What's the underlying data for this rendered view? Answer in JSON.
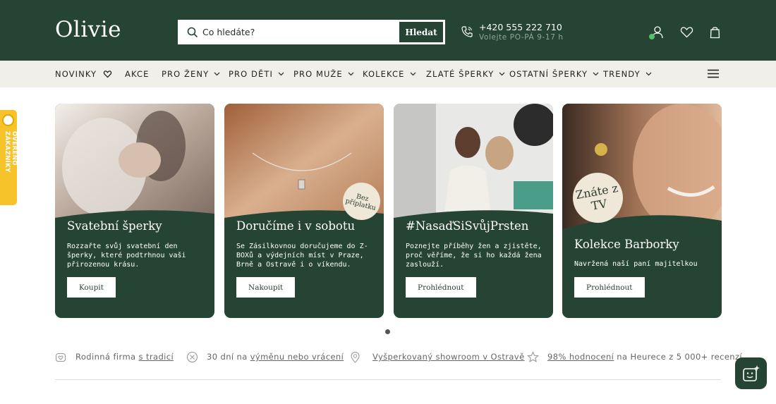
{
  "brand": {
    "logo_text": "Olivie",
    "primary_color": "#254433",
    "accent_color": "#f1efea"
  },
  "header": {
    "search_placeholder": "Co hledáte?",
    "search_button": "Hledat",
    "phone": "+420 555 222 710",
    "hours": "Volejte PO-PÁ 9-17 h",
    "icons": [
      "search-icon",
      "phone-icon",
      "user-icon",
      "heart-icon",
      "bag-icon"
    ]
  },
  "nav": {
    "items": [
      {
        "label": "NOVINKY",
        "icon": "heart-icon"
      },
      {
        "label": "AKCE"
      },
      {
        "label": "PRO ŽENY",
        "dropdown": true
      },
      {
        "label": "PRO DĚTI",
        "dropdown": true
      },
      {
        "label": "PRO MUŽE",
        "dropdown": true
      },
      {
        "label": "KOLEKCE",
        "dropdown": true
      },
      {
        "label": "ZLATÉ ŠPERKY",
        "dropdown": true
      },
      {
        "label": "OSTATNÍ ŠPERKY",
        "dropdown": true
      },
      {
        "label": "TRENDY",
        "dropdown": true
      }
    ],
    "menu_icon": "hamburger-icon"
  },
  "side_badge": {
    "text": "OVĚŘENO ZÁKAZNÍKY"
  },
  "cards": [
    {
      "title": "Svatební šperky",
      "description": "Rozzařte svůj svatební den šperky, které podtrhnou vaši přirozenou krásu.",
      "button": "Koupit"
    },
    {
      "title": "Doručíme i v sobotu",
      "description": "Se Zásilkovnou doručujeme do Z-BOXů a výdejních míst v Praze, Brně a Ostravě i o víkendu.",
      "button": "Nakoupit",
      "stamp": "Bez příplatku"
    },
    {
      "title": "#NasaďSiSvůjPrsten",
      "description": "Poznejte příběhy žen a zjistěte, proč věříme, že si ho každá žena zaslouží.",
      "button": "Prohlédnout"
    },
    {
      "title": "Kolekce Barborky",
      "description": "Navržená naší paní majitelkou",
      "button": "Prohlédnout",
      "stamp": "Znáte z TV"
    }
  ],
  "usp": [
    {
      "before": "Rodinná firma",
      "link": "s tradicí",
      "after": "",
      "icon": "heart-hand-icon"
    },
    {
      "before": "30 dní na",
      "link": "výměnu nebo vrácení",
      "after": "",
      "icon": "return-icon"
    },
    {
      "before": "",
      "link": "Vyšperkovaný showroom v Ostravě",
      "after": "",
      "icon": "location-icon"
    },
    {
      "before": "",
      "link": "98% hodnocení",
      "after": "na Heurece z 5 000+ recenzí",
      "icon": "star-icon"
    }
  ],
  "chat": {
    "icon": "chat-sparkle-icon"
  }
}
